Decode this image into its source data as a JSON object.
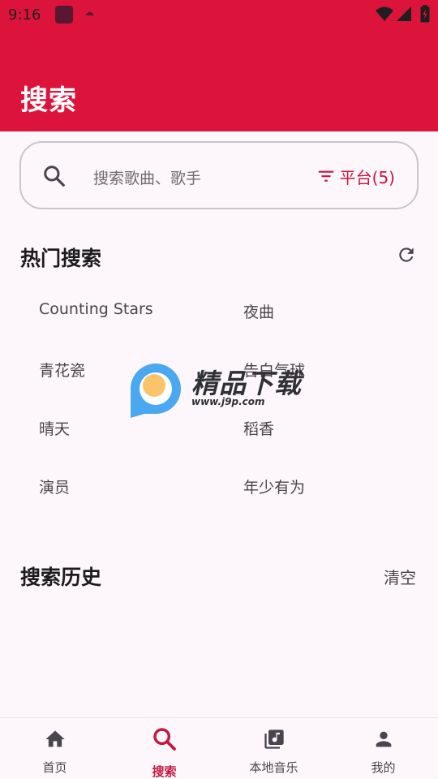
{
  "status_bar": {
    "time": "9:16",
    "icons": [
      "app-notification-icon",
      "cloud-icon",
      "wifi-icon",
      "signal-icon",
      "battery-icon"
    ]
  },
  "header": {
    "title": "搜索",
    "background": "#dc143c"
  },
  "search": {
    "placeholder": "搜索歌曲、歌手",
    "platform_label": "平台(5)",
    "accent": "#c4183f"
  },
  "hot_search": {
    "title": "热门搜索",
    "items": [
      "Counting Stars",
      "夜曲",
      "青花瓷",
      "告白气球",
      "晴天",
      "稻香",
      "演员",
      "年少有为"
    ]
  },
  "history": {
    "title": "搜索历史",
    "clear_label": "清空"
  },
  "watermark": {
    "text": "精品下载",
    "url": "www.j9p.com"
  },
  "bottom_nav": {
    "items": [
      {
        "label": "首页",
        "icon": "home-icon"
      },
      {
        "label": "搜索",
        "icon": "search-icon",
        "active": true
      },
      {
        "label": "本地音乐",
        "icon": "library-music-icon"
      },
      {
        "label": "我的",
        "icon": "person-icon"
      }
    ]
  }
}
